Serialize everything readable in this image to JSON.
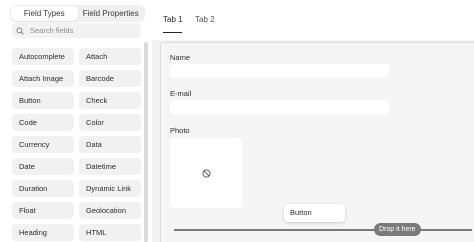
{
  "sidebar": {
    "tabs": [
      {
        "label": "Field Types",
        "active": true
      },
      {
        "label": "Field Properties",
        "active": false
      }
    ],
    "search": {
      "placeholder": "Search fields",
      "value": ""
    },
    "fields": [
      "Autocomplete",
      "Attach",
      "Attach Image",
      "Barcode",
      "Button",
      "Check",
      "Code",
      "Color",
      "Currency",
      "Data",
      "Date",
      "Datetime",
      "Duration",
      "Dynamic Link",
      "Float",
      "Geolocation",
      "Heading",
      "HTML"
    ]
  },
  "main": {
    "tabs": [
      {
        "label": "Tab 1",
        "active": true
      },
      {
        "label": "Tab 2",
        "active": false
      }
    ],
    "form": {
      "name_label": "Name",
      "email_label": "E-mail",
      "photo_label": "Photo"
    },
    "drop_label": "Drop it here",
    "drag_ghost_label": "Button"
  },
  "colors": {
    "page_bg": "#f3f3f3",
    "panel_bg": "#ffffff",
    "field_bg": "#f1f1f1",
    "drop_indicator": "#7a7a7a",
    "text": "#1f272e"
  },
  "icons": {
    "search": "search-icon",
    "photo_placeholder": "no-image-icon"
  }
}
